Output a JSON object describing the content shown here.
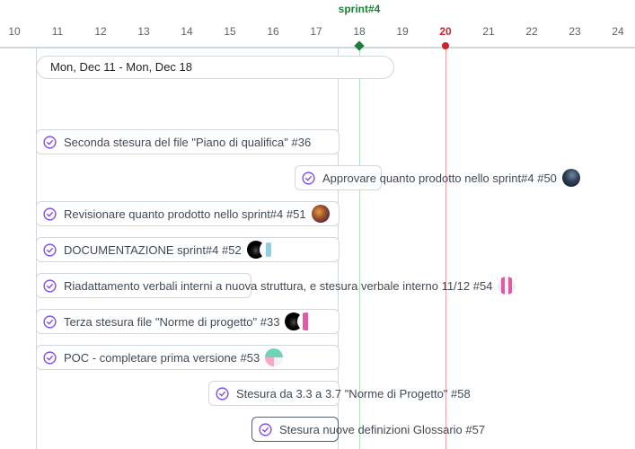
{
  "timeline": {
    "sprint_label": "sprint#4",
    "today_label": "20",
    "days": [
      "10",
      "11",
      "12",
      "13",
      "14",
      "15",
      "16",
      "17",
      "18",
      "19",
      "20",
      "21",
      "22",
      "23",
      "24"
    ]
  },
  "iteration": {
    "range_label": "Mon, Dec 11 - Mon, Dec 18"
  },
  "items": [
    {
      "title": "Seconda stesura del file \"Piano di qualifica\" #36",
      "status": "closed",
      "avatars": []
    },
    {
      "title": "Approvare quanto prodotto nello sprint#4 #50",
      "status": "closed",
      "avatars": [
        "avatar-dark-landscape"
      ]
    },
    {
      "title": "Revisionare quanto prodotto nello sprint#4 #51",
      "status": "closed",
      "avatars": [
        "avatar-autumn-photo"
      ]
    },
    {
      "title": "DOCUMENTAZIONE sprint#4 #52",
      "status": "closed",
      "avatars": [
        "avatar-black-eye",
        "avatar-teal-identicon"
      ]
    },
    {
      "title": "Riadattamento verbali interni a nuova struttura, e stesura verbale interno 11/12 #54",
      "status": "closed",
      "avatars": [
        "avatar-pink-identicon"
      ]
    },
    {
      "title": "Terza stesura file \"Norme di progetto\" #33",
      "status": "closed",
      "avatars": [
        "avatar-black-eye",
        "avatar-pink-identicon"
      ]
    },
    {
      "title": "POC - completare prima versione #53",
      "status": "closed",
      "avatars": [
        "avatar-green-identicon"
      ]
    },
    {
      "title": "Stesura da 3.3 a 3.7 \"Norme di Progetto\" #58",
      "status": "closed",
      "avatars": []
    },
    {
      "title": "Stesura nuove definizioni Glossario #57",
      "status": "closed",
      "avatars": []
    }
  ],
  "colors": {
    "closed_icon": "#8250df",
    "today_marker": "#cf222e",
    "sprint_marker": "#1a7f37",
    "bar_border": "#d0d7de"
  }
}
